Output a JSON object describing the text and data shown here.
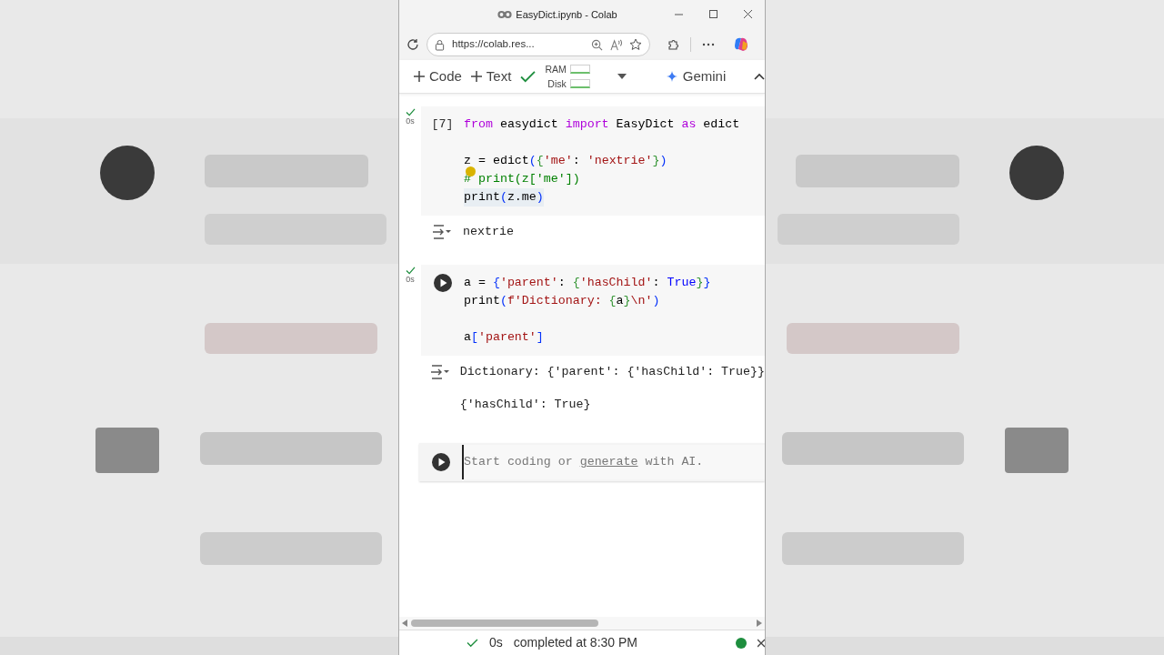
{
  "window": {
    "title": "EasyDict.ipynb - Colab"
  },
  "address_bar": {
    "url": "https://colab.res..."
  },
  "toolbar": {
    "buttons": [
      {
        "label": "Code"
      },
      {
        "label": "Text"
      }
    ],
    "connected": true,
    "resources": [
      {
        "label": "RAM"
      },
      {
        "label": "Disk"
      }
    ],
    "assistant": "Gemini"
  },
  "cells": [
    {
      "exec_count": "[7]",
      "status": "0s",
      "done": true,
      "blocks": [
        [
          {
            "tokens": [
              {
                "kind": "kw",
                "t": "from"
              },
              {
                "kind": "plain",
                "t": " easydict "
              },
              {
                "kind": "kw",
                "t": "import"
              },
              {
                "kind": "plain",
                "t": " EasyDict "
              },
              {
                "kind": "kw",
                "t": "as"
              },
              {
                "kind": "plain",
                "t": " edict"
              }
            ]
          }
        ],
        [
          {
            "tokens": [
              {
                "kind": "plain",
                "t": "z = edict"
              },
              {
                "kind": "b1",
                "t": "("
              },
              {
                "kind": "b2",
                "t": "{"
              },
              {
                "kind": "str",
                "t": "'me'"
              },
              {
                "kind": "plain",
                "t": ": "
              },
              {
                "kind": "str",
                "t": "'nextrie'"
              },
              {
                "kind": "b2",
                "t": "}"
              },
              {
                "kind": "b1",
                "t": ")"
              }
            ]
          },
          {
            "hint": true,
            "tokens": [
              {
                "kind": "comment",
                "t": "# print(z['me'])"
              }
            ]
          },
          {
            "highlighted": true,
            "tokens": [
              {
                "kind": "plain",
                "t": "print"
              },
              {
                "kind": "b1",
                "t": "("
              },
              {
                "kind": "plain",
                "t": "z.me"
              },
              {
                "kind": "b1",
                "t": ")"
              }
            ]
          }
        ]
      ],
      "outputs": [
        "nextrie"
      ]
    },
    {
      "status": "0s",
      "done": true,
      "blocks": [
        [
          {
            "tokens": [
              {
                "kind": "plain",
                "t": "a = "
              },
              {
                "kind": "b1",
                "t": "{"
              },
              {
                "kind": "str",
                "t": "'parent'"
              },
              {
                "kind": "plain",
                "t": ": "
              },
              {
                "kind": "b2",
                "t": "{"
              },
              {
                "kind": "str",
                "t": "'hasChild'"
              },
              {
                "kind": "plain",
                "t": ": "
              },
              {
                "kind": "bool",
                "t": "True"
              },
              {
                "kind": "b2",
                "t": "}"
              },
              {
                "kind": "b1",
                "t": "}"
              }
            ]
          },
          {
            "tokens": [
              {
                "kind": "plain",
                "t": "print"
              },
              {
                "kind": "b1",
                "t": "("
              },
              {
                "kind": "str",
                "t": "f'Dictionary: "
              },
              {
                "kind": "b2",
                "t": "{"
              },
              {
                "kind": "plain",
                "t": "a"
              },
              {
                "kind": "b2",
                "t": "}"
              },
              {
                "kind": "str",
                "t": "\\n'"
              },
              {
                "kind": "b1",
                "t": ")"
              }
            ]
          }
        ],
        [
          {
            "tokens": [
              {
                "kind": "plain",
                "t": "a"
              },
              {
                "kind": "b1",
                "t": "["
              },
              {
                "kind": "str",
                "t": "'parent'"
              },
              {
                "kind": "b1",
                "t": "]"
              }
            ]
          }
        ]
      ],
      "outputs": [
        "Dictionary: {'parent': {'hasChild': True}}",
        "{'hasChild': True}"
      ]
    }
  ],
  "new_cell": {
    "placeholder": [
      {
        "t": "Start coding or ",
        "link": false
      },
      {
        "t": "generate",
        "link": true
      },
      {
        "t": " with AI.",
        "link": false
      }
    ]
  },
  "status_bar": {
    "duration": "0s",
    "text": "completed at 8:30 PM",
    "connected": true
  }
}
